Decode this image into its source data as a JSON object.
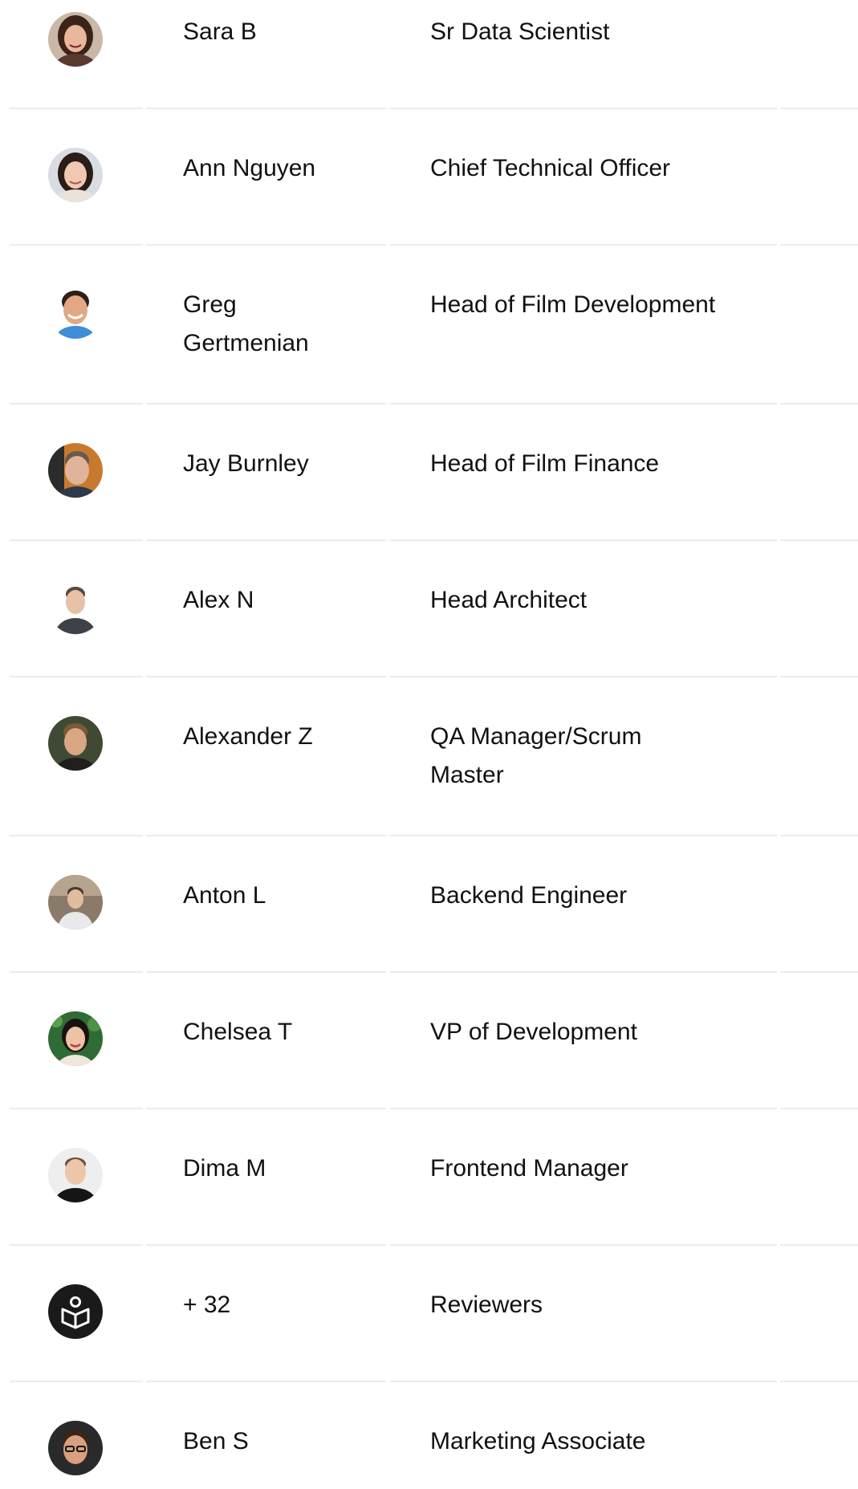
{
  "team": {
    "members": [
      {
        "name": "Sara B",
        "role": "Sr Data Scientist",
        "avatar_icon": "person-photo"
      },
      {
        "name": "Ann Nguyen",
        "role": "Chief Technical Officer",
        "avatar_icon": "person-photo"
      },
      {
        "name": "Greg Gertmenian",
        "role": "Head of Film Development",
        "avatar_icon": "person-photo"
      },
      {
        "name": "Jay Burnley",
        "role": "Head of Film Finance",
        "avatar_icon": "person-photo"
      },
      {
        "name": "Alex N",
        "role": "Head Architect",
        "avatar_icon": "person-photo"
      },
      {
        "name": "Alexander Z",
        "role": "QA Manager/Scrum Master",
        "avatar_icon": "person-photo"
      },
      {
        "name": "Anton L",
        "role": "Backend Engineer",
        "avatar_icon": "person-photo"
      },
      {
        "name": "Chelsea T",
        "role": "VP of Development",
        "avatar_icon": "person-photo"
      },
      {
        "name": "Dima M",
        "role": "Frontend Manager",
        "avatar_icon": "person-photo"
      },
      {
        "name": "+ 32",
        "role": "Reviewers",
        "avatar_icon": "reader-book-icon"
      },
      {
        "name": "Ben S",
        "role": "Marketing Associate",
        "avatar_icon": "person-photo"
      }
    ]
  },
  "colors": {
    "divider": "#ececec",
    "text": "#111111",
    "reviewer_badge": "#1a1a1a"
  }
}
